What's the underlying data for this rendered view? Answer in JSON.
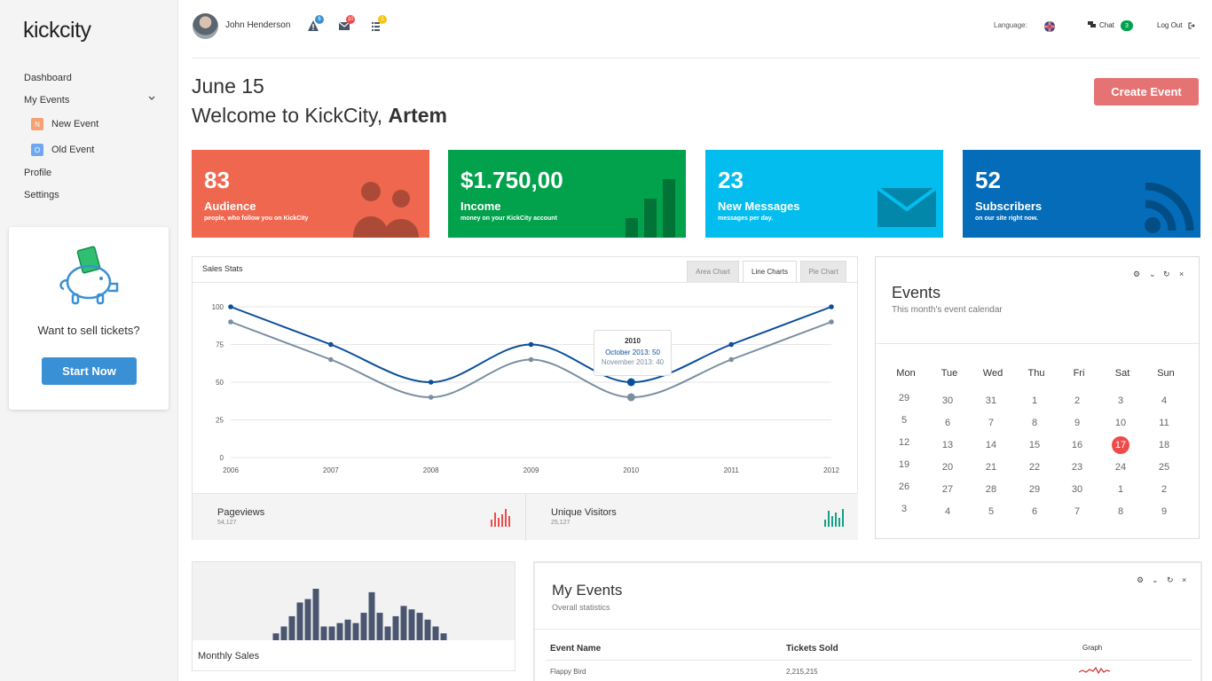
{
  "brand": "kickcity",
  "sidebar": {
    "items": [
      {
        "label": "Dashboard"
      },
      {
        "label": "My Events"
      },
      {
        "label": "Profile"
      },
      {
        "label": "Settings"
      }
    ],
    "sub_items": [
      {
        "badge": "N",
        "label": "New Event",
        "color": "#f5a173"
      },
      {
        "badge": "O",
        "label": "Old Event",
        "color": "#6fa8f0"
      }
    ],
    "promo": {
      "text": "Want to sell tickets?",
      "button": "Start Now"
    }
  },
  "header": {
    "user": "John Henderson",
    "alerts_count": "6",
    "messages_count": "10",
    "tasks_count": "1",
    "language_label": "Language:",
    "chat_label": "Chat",
    "chat_count": "3",
    "logout_label": "Log Out"
  },
  "page": {
    "date": "June 15",
    "welcome_prefix": "Welcome to KickCity,",
    "welcome_name": "Artem",
    "create_button": "Create Event"
  },
  "stats": [
    {
      "value": "83",
      "label": "Audience",
      "sub": "people, who follow you on KickCity",
      "color": "#f0674f"
    },
    {
      "value": "$1.750,00",
      "label": "Income",
      "sub": "money on your KickCity account",
      "color": "#02a14c"
    },
    {
      "value": "23",
      "label": "New Messages",
      "sub": "messages per day.",
      "color": "#03bdee"
    },
    {
      "value": "52",
      "label": "Subscribers",
      "sub": "on our site right now.",
      "color": "#046cb8"
    }
  ],
  "sales": {
    "title": "Sales Stats",
    "tabs": [
      "Area Chart",
      "Line Charts",
      "Pie Chart"
    ],
    "active_tab": 1,
    "tooltip": {
      "title": "2010",
      "line1": "October 2013: 50",
      "line2": "November 2013: 40"
    },
    "footer": [
      {
        "label": "Pageviews",
        "value": "54,127"
      },
      {
        "label": "Unique Visitors",
        "value": "25,127"
      }
    ]
  },
  "chart_data": [
    {
      "type": "line",
      "x": [
        "2006",
        "2007",
        "2008",
        "2009",
        "2010",
        "2011",
        "2012"
      ],
      "series": [
        {
          "name": "October 2013",
          "values": [
            100,
            75,
            50,
            75,
            50,
            75,
            100
          ],
          "color": "#0b4f9a"
        },
        {
          "name": "November 2013",
          "values": [
            90,
            65,
            40,
            65,
            40,
            65,
            90
          ],
          "color": "#7a8ea1"
        }
      ],
      "yticks": [
        0,
        25,
        50,
        75,
        100
      ],
      "ylim": [
        0,
        100
      ],
      "grid": true
    },
    {
      "type": "bar",
      "title": "Monthly Sales",
      "values": [
        2,
        4,
        7,
        11,
        12,
        15,
        4,
        4,
        5,
        6,
        5,
        8,
        14,
        8,
        4,
        7,
        10,
        9,
        8,
        6,
        4,
        2
      ],
      "color": "#4a5670"
    }
  ],
  "events": {
    "title": "Events",
    "subtitle": "This month's event calendar",
    "weekdays": [
      "Mon",
      "Tue",
      "Wed",
      "Thu",
      "Fri",
      "Sat",
      "Sun"
    ],
    "weeks": [
      [
        "29",
        "30",
        "31",
        "1",
        "2",
        "3",
        "4"
      ],
      [
        "5",
        "6",
        "7",
        "8",
        "9",
        "10",
        "11"
      ],
      [
        "12",
        "13",
        "14",
        "15",
        "16",
        "17",
        "18"
      ],
      [
        "19",
        "20",
        "21",
        "22",
        "23",
        "24",
        "25"
      ],
      [
        "26",
        "27",
        "28",
        "29",
        "30",
        "1",
        "2"
      ],
      [
        "3",
        "4",
        "5",
        "6",
        "7",
        "8",
        "9"
      ]
    ],
    "highlight": "17"
  },
  "my_events": {
    "title": "My Events",
    "subtitle": "Overall statistics",
    "columns": [
      "Event Name",
      "Tickets Sold",
      "Graph"
    ],
    "rows": [
      {
        "name": "Flappy Bird",
        "sold": "2,215,215"
      }
    ]
  }
}
